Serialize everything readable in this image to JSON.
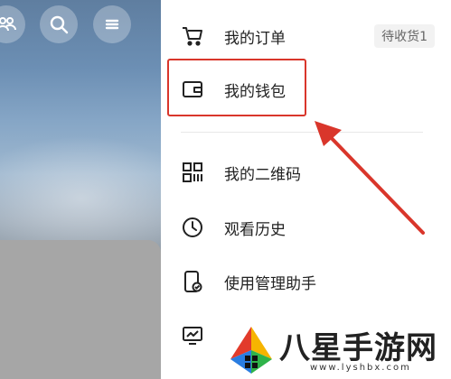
{
  "menu": {
    "items": [
      {
        "label": "我的订单",
        "icon": "cart-icon",
        "badge": "待收货1"
      },
      {
        "label": "我的钱包",
        "icon": "wallet-icon"
      },
      {
        "label": "我的二维码",
        "icon": "qr-code-icon"
      },
      {
        "label": "观看历史",
        "icon": "clock-icon"
      },
      {
        "label": "使用管理助手",
        "icon": "phone-check-icon"
      },
      {
        "label": "",
        "icon": "monitor-chart-icon"
      }
    ]
  },
  "watermark": {
    "title": "八星手游网",
    "url": "www.lyshbx.com"
  },
  "colors": {
    "highlight": "#d9362b",
    "arrow": "#d9362b"
  }
}
